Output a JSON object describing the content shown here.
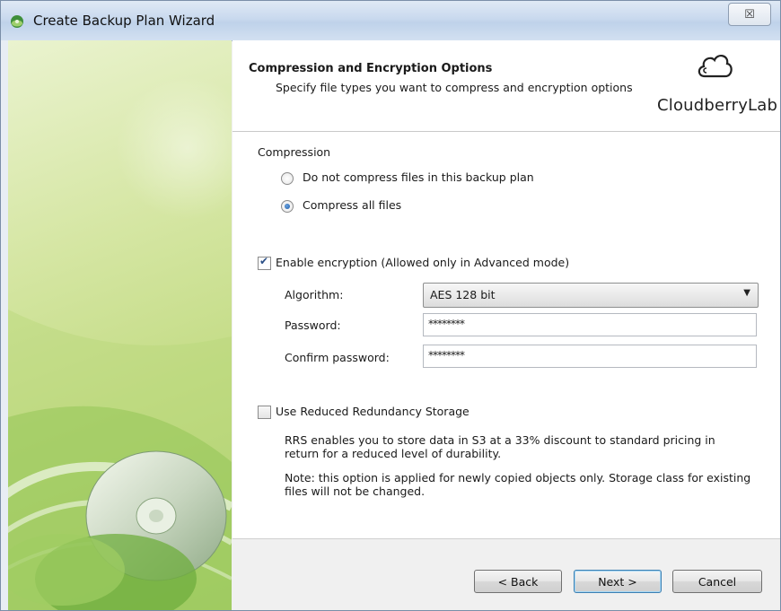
{
  "window": {
    "title": "Create Backup Plan Wizard",
    "close_glyph": "☒"
  },
  "header": {
    "title": "Compression and Encryption Options",
    "subtitle": "Specify file types you want to compress and encryption options",
    "logo_text": "CloudberryLab",
    "logo_icon": "cloud-icon"
  },
  "compression": {
    "group_label": "Compression",
    "options": [
      {
        "label": "Do not compress files in this backup plan",
        "selected": false
      },
      {
        "label": "Compress all files",
        "selected": true
      }
    ]
  },
  "encryption": {
    "enable_label": "Enable encryption (Allowed only in Advanced mode)",
    "enabled": true,
    "algorithm_label": "Algorithm:",
    "algorithm_value": "AES 128 bit",
    "password_label": "Password:",
    "password_value": "********",
    "confirm_label": "Confirm password:",
    "confirm_value": "********"
  },
  "rrs": {
    "label": "Use Reduced Redundancy Storage",
    "checked": false,
    "description": "RRS enables you to store data in S3 at a 33% discount to standard pricing in return for a reduced level of durability.",
    "note": "Note: this option is applied for newly copied objects only. Storage class for existing files will not be changed."
  },
  "buttons": {
    "back": "< Back",
    "next": "Next >",
    "cancel": "Cancel"
  }
}
